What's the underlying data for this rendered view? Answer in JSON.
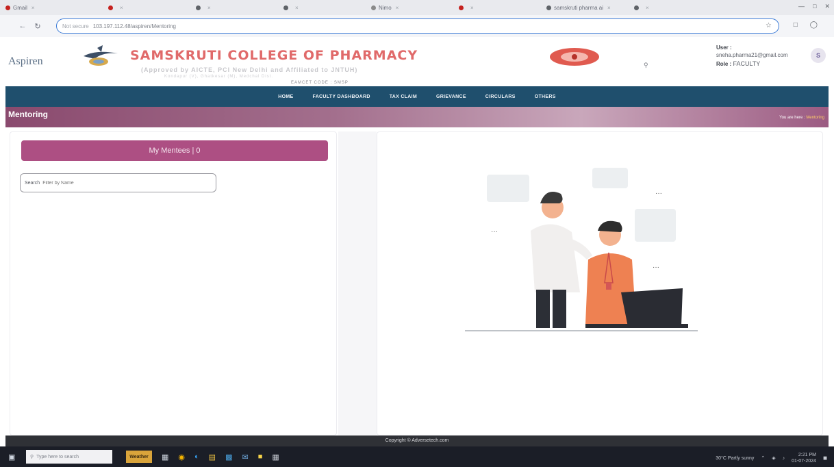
{
  "browser": {
    "tabs": [
      {
        "label": "Gmail",
        "color": "#c5221f"
      },
      {
        "label": "",
        "color": "#c5221f"
      },
      {
        "label": "",
        "color": "#5f6368"
      },
      {
        "label": "",
        "color": "#5f6368"
      },
      {
        "label": "Nimo",
        "color": "#8a8a8a"
      },
      {
        "label": "",
        "color": "#c5221f"
      },
      {
        "label": "samskruti pharma ai",
        "color": "#5f6368"
      },
      {
        "label": "",
        "color": "#5f6368"
      }
    ],
    "address_prefix": "Not secure",
    "address_url": "103.197.112.48/aspiren/Mentoring"
  },
  "header": {
    "aspiren_logo": "Aspiren",
    "college_name": "SAMSKRUTI COLLEGE OF PHARMACY",
    "approval_line": "(Approved by AICTE, PCI New Delhi and Affiliated to JNTUH)",
    "approval_line2": "Kondapur (V), Ghatkesar (M), Medchal Dist.",
    "approval_line3": "EAMCET CODE : SMSP",
    "user_label": "User :",
    "user_email": "sneha.pharma21@gmail.com",
    "role_label": "Role :",
    "role_value": "FACULTY",
    "avatar_initial": "S"
  },
  "nav": {
    "items": [
      "HOME",
      "FACULTY DASHBOARD",
      "TAX CLAIM",
      "GRIEVANCE",
      "CIRCULARS",
      "OTHERS"
    ]
  },
  "page": {
    "title": "Mentoring",
    "breadcrumb_prefix": "You are here :",
    "breadcrumb_current": "Mentoring"
  },
  "mentees": {
    "heading": "My Mentees | 0",
    "search_label": "Search",
    "search_placeholder": "Filter by Name"
  },
  "footer": {
    "copyright": "Copyright © Adversetech.com"
  },
  "taskbar": {
    "search_placeholder": "Type here to search",
    "weather_badge": "Weather",
    "weather_text": "30°C Partly sunny",
    "time": "2:21 PM",
    "date": "01-07-2024"
  },
  "colors": {
    "nav_bg": "#1f4f6d",
    "accent_mentees": "#ad4f83",
    "college_name": "#e06a6a"
  }
}
